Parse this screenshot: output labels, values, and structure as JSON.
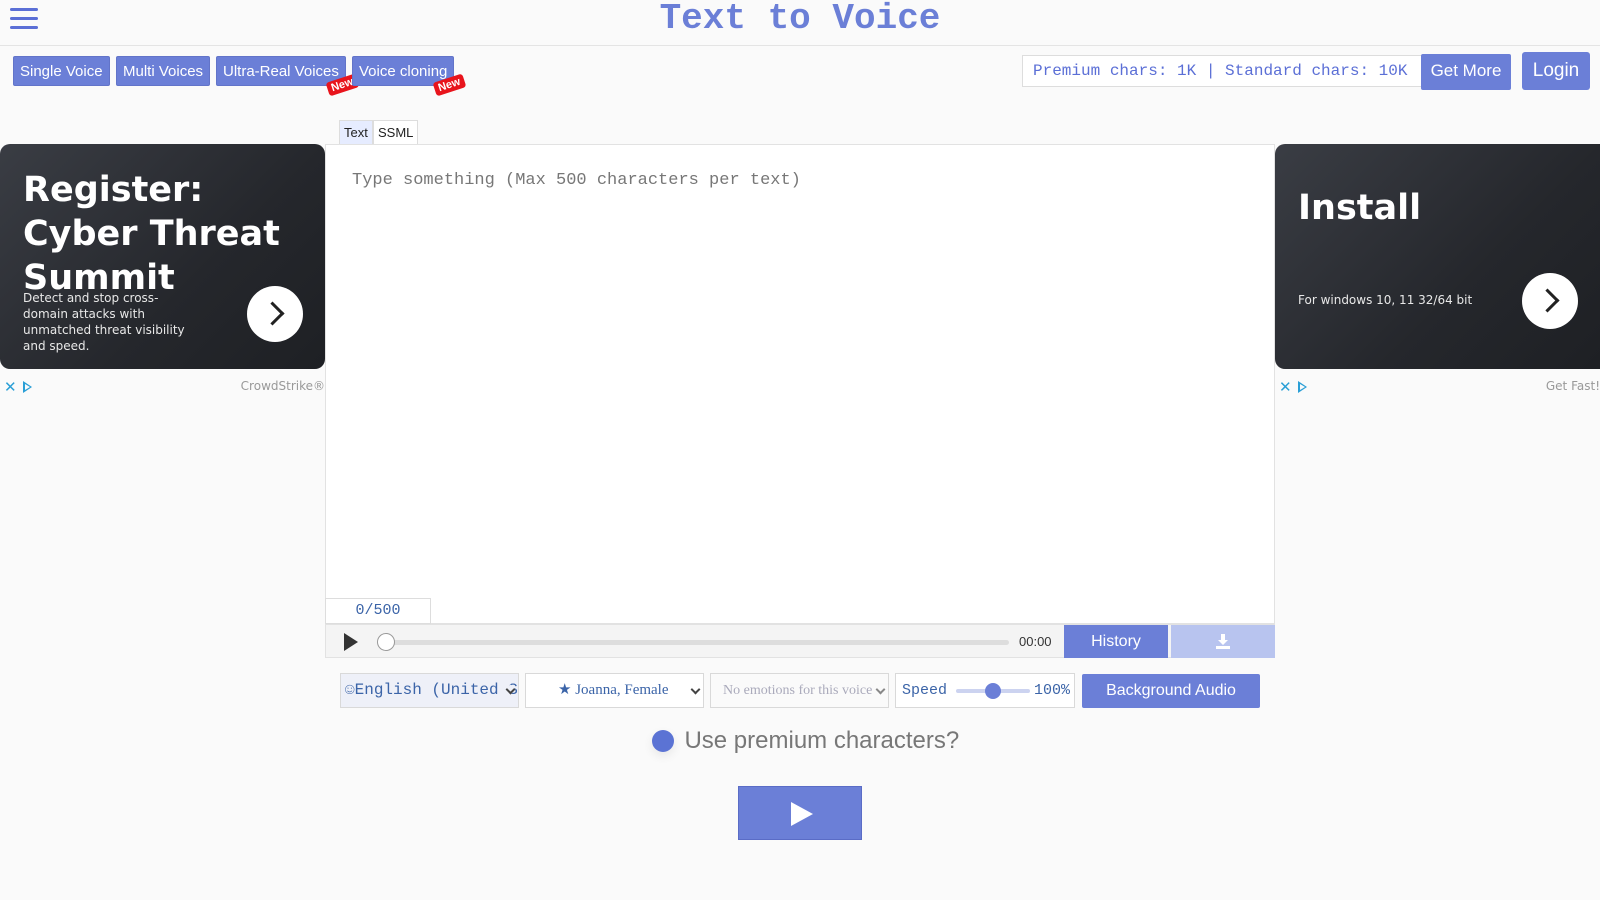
{
  "header": {
    "title": "Text to Voice"
  },
  "nav": {
    "buttons": [
      {
        "label": "Single Voice"
      },
      {
        "label": "Multi Voices"
      },
      {
        "label": "Ultra-Real Voices",
        "badge": "New"
      },
      {
        "label": "Voice cloning",
        "badge": "New"
      }
    ]
  },
  "account": {
    "chars_info": "Premium chars: 1K | Standard chars: 10K",
    "get_more_label": "Get More",
    "login_label": "Login"
  },
  "editor": {
    "tabs": [
      {
        "label": "Text",
        "active": true
      },
      {
        "label": "SSML",
        "active": false
      }
    ],
    "placeholder": "Type something (Max 500 characters per text)",
    "counter": "0/500"
  },
  "player": {
    "time": "00:00",
    "history_label": "History"
  },
  "controls": {
    "language": "English (United States)",
    "voice": "Joanna, Female",
    "emotion": "No emotions for this voice",
    "speed_label": "Speed",
    "speed_value": "100%",
    "speed_level": 0.5,
    "background_audio_label": "Background Audio"
  },
  "premium": {
    "question": "Use premium characters?"
  },
  "ads": {
    "left": {
      "title": "Register: Cyber Threat Summit",
      "body": "Detect and stop cross-domain attacks with unmatched threat visibility and speed.",
      "brand": "CrowdStrike®"
    },
    "right": {
      "title": "Install",
      "body": "For windows 10, 11 32/64 bit",
      "brand": "Get Fast!"
    }
  },
  "colors": {
    "accent": "#6b7fd7",
    "badge": "#e8141c",
    "title": "#6b7fd7"
  }
}
